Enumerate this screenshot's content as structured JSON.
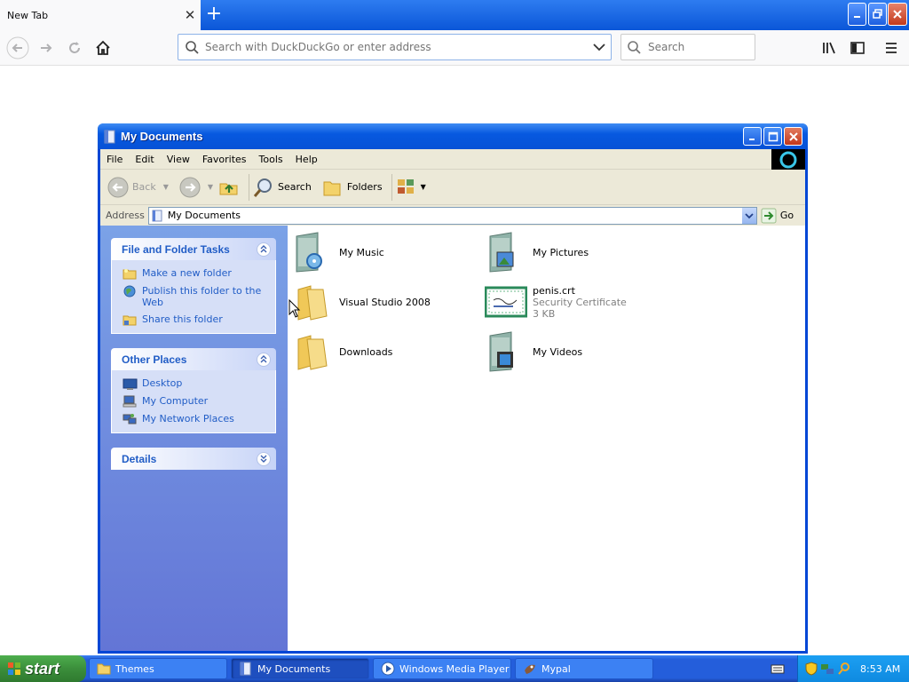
{
  "browser": {
    "tab_title": "New Tab",
    "url_placeholder": "Search with DuckDuckGo or enter address",
    "search_placeholder": "Search"
  },
  "window": {
    "title": "My Documents",
    "menu": [
      "File",
      "Edit",
      "View",
      "Favorites",
      "Tools",
      "Help"
    ],
    "toolbar": {
      "back": "Back",
      "search": "Search",
      "folders": "Folders"
    },
    "address_label": "Address",
    "address_value": "My Documents",
    "go_label": "Go"
  },
  "task_pane": {
    "file_tasks": {
      "title": "File and Folder Tasks",
      "items": [
        "Make a new folder",
        "Publish this folder to the Web",
        "Share this folder"
      ]
    },
    "other_places": {
      "title": "Other Places",
      "items": [
        "Desktop",
        "My Computer",
        "My Network Places"
      ]
    },
    "details": {
      "title": "Details"
    }
  },
  "files": [
    {
      "name": "My Music"
    },
    {
      "name": "My Pictures"
    },
    {
      "name": "Visual Studio 2008"
    },
    {
      "name": "penis.crt",
      "type": "Security Certificate",
      "size": "3 KB"
    },
    {
      "name": "Downloads"
    },
    {
      "name": "My Videos"
    }
  ],
  "taskbar": {
    "start_label": "start",
    "tasks": [
      "Themes",
      "My Documents",
      "Windows Media Player",
      "Mypal"
    ],
    "clock": "8:53 AM"
  }
}
